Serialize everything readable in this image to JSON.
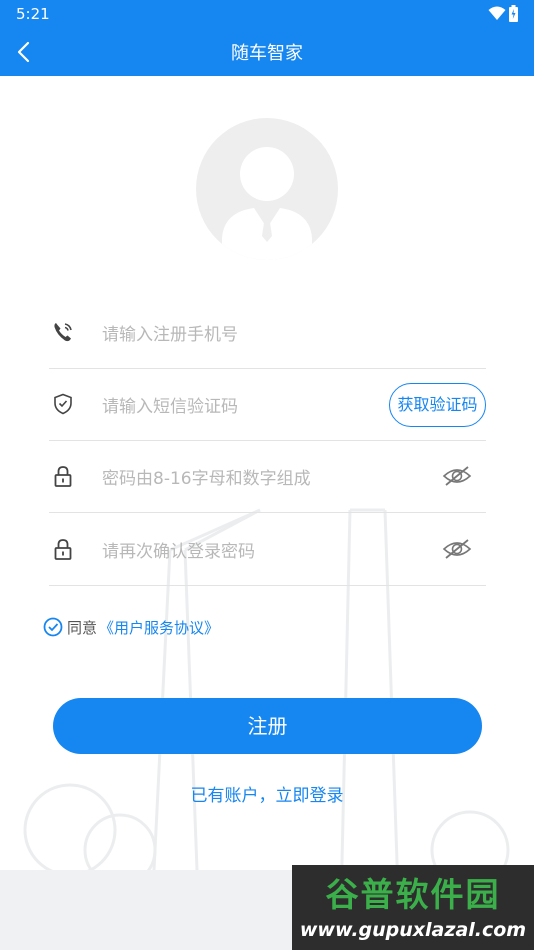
{
  "status_bar": {
    "time": "5:21"
  },
  "app_bar": {
    "title": "随车智家"
  },
  "form": {
    "phone_placeholder": "请输入注册手机号",
    "sms_placeholder": "请输入短信验证码",
    "sms_button": "获取验证码",
    "password_placeholder": "密码由8-16字母和数字组成",
    "confirm_placeholder": "请再次确认登录密码"
  },
  "agreement": {
    "prefix": "同意",
    "link": "《用户服务协议》",
    "checked": true
  },
  "submit_label": "注册",
  "login_link": "已有账户，立即登录",
  "watermark": {
    "brand": "谷普软件园",
    "url": "www.gupuxlazal.com"
  },
  "colors": {
    "accent": "#1686f1",
    "placeholder": "#b8b8b8",
    "divider": "#e3e3e3"
  }
}
